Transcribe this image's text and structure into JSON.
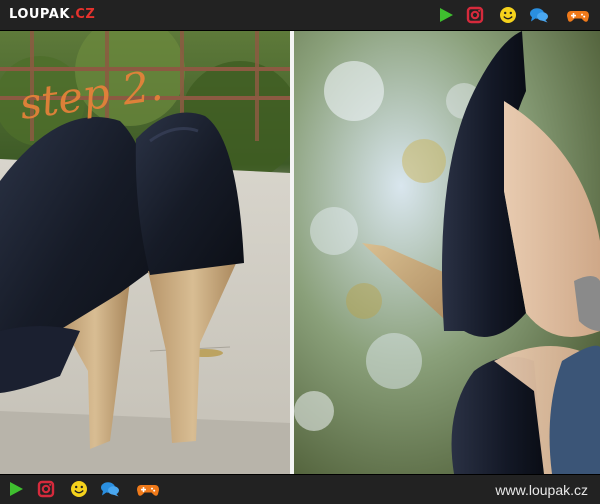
{
  "header": {
    "logo_text": "LOUPAK",
    "logo_suffix": ".CZ",
    "icons": [
      "play-icon",
      "instagram-icon",
      "smiley-icon",
      "chat-icon",
      "gamepad-icon"
    ]
  },
  "main": {
    "left_photo": {
      "caption": "step 2."
    },
    "right_photo": {}
  },
  "footer": {
    "icons": [
      "play-icon",
      "instagram-icon",
      "smiley-icon",
      "chat-icon",
      "gamepad-icon"
    ],
    "site_url": "www.loupak.cz"
  },
  "colors": {
    "bar_bg": "#222222",
    "logo_suffix": "#e5322d",
    "play": "#3fbf2f",
    "instagram": "#d62a3c",
    "smiley": "#f5d21c",
    "chat": "#2a8fe0",
    "gamepad": "#f07a1a"
  }
}
